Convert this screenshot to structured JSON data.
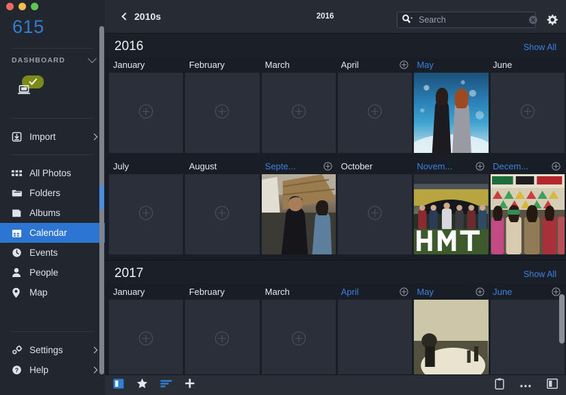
{
  "window": {
    "traffic_lights": [
      "close",
      "minimize",
      "zoom"
    ],
    "colors": {
      "close": "#ec6a5f",
      "minimize": "#f4bd4f",
      "zoom": "#61c555"
    }
  },
  "sidebar": {
    "brand": "615",
    "section_label": "DASHBOARD",
    "dashboard_badge": "check",
    "groups": [
      {
        "items": [
          {
            "label": "Import",
            "icon": "import-icon",
            "arrow": true,
            "active": false
          }
        ]
      },
      {
        "items": [
          {
            "label": "All Photos",
            "icon": "grid-icon",
            "arrow": false,
            "active": false
          },
          {
            "label": "Folders",
            "icon": "folder-icon",
            "arrow": false,
            "active": false
          },
          {
            "label": "Albums",
            "icon": "albums-icon",
            "arrow": false,
            "active": false
          },
          {
            "label": "Calendar",
            "icon": "calendar-icon",
            "arrow": false,
            "active": true
          },
          {
            "label": "Events",
            "icon": "clock-icon",
            "arrow": false,
            "active": false
          },
          {
            "label": "People",
            "icon": "person-icon",
            "arrow": false,
            "active": false
          },
          {
            "label": "Map",
            "icon": "pin-icon",
            "arrow": false,
            "active": false
          }
        ]
      },
      {
        "items": [
          {
            "label": "Settings",
            "icon": "gear-icon",
            "arrow": true,
            "active": false
          },
          {
            "label": "Help",
            "icon": "help-icon",
            "arrow": true,
            "active": false
          }
        ]
      }
    ]
  },
  "topbar": {
    "back_label": "2010s",
    "center_label": "2016",
    "search_placeholder": "Search",
    "search_value": "",
    "gear_title": "settings-icon"
  },
  "accent": {
    "blue": "#3b82e0",
    "selection": "#2c76d2",
    "badge_green": "#7b8a18"
  },
  "years": [
    {
      "title": "2016",
      "show_all": "Show All",
      "rows": [
        {
          "months": [
            {
              "label": "January",
              "linked": false,
              "plus": false,
              "photo": null
            },
            {
              "label": "February",
              "linked": false,
              "plus": false,
              "photo": null
            },
            {
              "label": "March",
              "linked": false,
              "plus": false,
              "photo": null
            },
            {
              "label": "April",
              "linked": false,
              "plus": false,
              "photo": null
            },
            {
              "label": "May",
              "linked": true,
              "plus": true,
              "photo": "p-may"
            },
            {
              "label": "June",
              "linked": false,
              "plus": false,
              "photo": null
            }
          ]
        },
        {
          "months": [
            {
              "label": "July",
              "linked": false,
              "plus": false,
              "photo": null
            },
            {
              "label": "August",
              "linked": false,
              "plus": false,
              "photo": null
            },
            {
              "label": "Septe...",
              "linked": true,
              "plus": true,
              "photo": "p-sep"
            },
            {
              "label": "October",
              "linked": false,
              "plus": false,
              "photo": null
            },
            {
              "label": "Novem...",
              "linked": true,
              "plus": true,
              "photo": "p-nov"
            },
            {
              "label": "Decem...",
              "linked": true,
              "plus": true,
              "photo": "p-dec"
            }
          ]
        }
      ]
    },
    {
      "title": "2017",
      "show_all": "Show All",
      "rows": [
        {
          "months": [
            {
              "label": "January",
              "linked": false,
              "plus": false,
              "photo": null
            },
            {
              "label": "February",
              "linked": false,
              "plus": false,
              "photo": null
            },
            {
              "label": "March",
              "linked": false,
              "plus": false,
              "photo": null
            },
            {
              "label": "April",
              "linked": true,
              "plus": true,
              "photo": null
            },
            {
              "label": "May",
              "linked": true,
              "plus": true,
              "photo": "p-2017may"
            },
            {
              "label": "June",
              "linked": true,
              "plus": true,
              "photo": null
            }
          ]
        }
      ]
    }
  ],
  "bottombar": {
    "left": [
      {
        "name": "sidebar-toggle-icon",
        "active": true
      },
      {
        "name": "star-icon",
        "active": false
      },
      {
        "name": "sort-icon",
        "active": true
      },
      {
        "name": "add-icon",
        "active": false
      }
    ],
    "right": [
      {
        "name": "clipboard-icon",
        "active": false
      },
      {
        "name": "more-icon",
        "active": false
      },
      {
        "name": "panel-toggle-icon",
        "active": false
      }
    ]
  }
}
